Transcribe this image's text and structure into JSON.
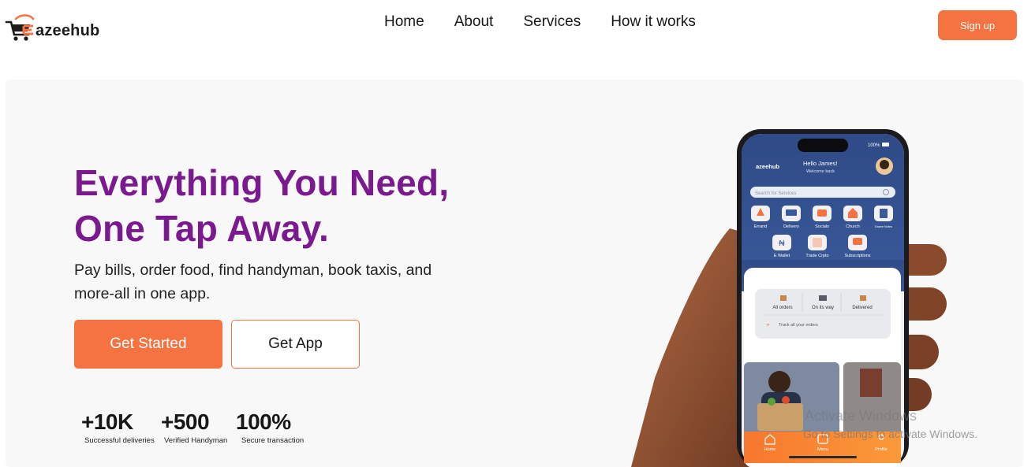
{
  "brand": {
    "name": "Eazeehub",
    "logo_text": "azeehub",
    "accent": "#f47340",
    "headline_color": "#7a1a8e"
  },
  "nav": {
    "items": [
      "Home",
      "About",
      "Services",
      "How it works"
    ],
    "signup_label": "Sign up"
  },
  "hero": {
    "headline_line1": "Everything You Need,",
    "headline_line2": "One Tap Away.",
    "subtitle": "Pay bills, order food, find handyman, book taxis, and more-all in one app.",
    "cta_primary": "Get Started",
    "cta_secondary": "Get App",
    "stats": [
      {
        "value": "+10K",
        "label": "Successful deliveries"
      },
      {
        "value": "+500",
        "label": "Verified Handyman"
      },
      {
        "value": "100%",
        "label": "Secure transaction"
      }
    ]
  },
  "phone": {
    "status_battery": "100%",
    "app_logo": "azeehub",
    "greeting": "Hello James!",
    "greeting_sub": "Welcome back",
    "search_placeholder": "Search for Services",
    "services_row1": [
      "Errand",
      "Delivery",
      "Socials",
      "Church",
      "Eazee Notes"
    ],
    "services_row2": [
      "E Wallet",
      "Trade Crpto",
      "Subscriptions"
    ],
    "order_tabs": [
      "All orders",
      "On its way",
      "Delivered"
    ],
    "track_label": "Track all your orders",
    "bottom_nav": [
      "Home",
      "Menu",
      "Profile"
    ]
  },
  "watermark": {
    "line1": "Activate Windows",
    "line2": "Go to Settings to activate Windows."
  }
}
